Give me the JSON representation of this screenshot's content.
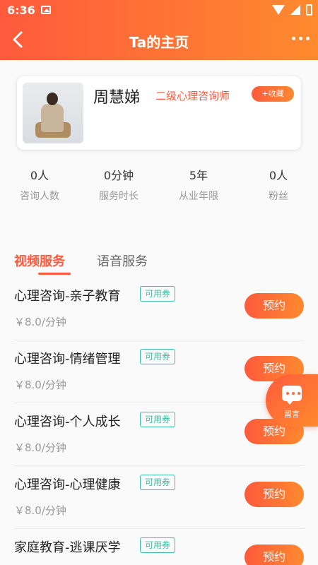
{
  "status_bar": {
    "time": "6:36"
  },
  "nav": {
    "title": "Ta的主页"
  },
  "profile": {
    "name": "周慧娣",
    "level": "二级心理咨询师",
    "favorite_label": "+收藏"
  },
  "stats": [
    {
      "value": "0人",
      "label": "咨询人数"
    },
    {
      "value": "0分钟",
      "label": "服务时长"
    },
    {
      "value": "5年",
      "label": "从业年限"
    },
    {
      "value": "0人",
      "label": "粉丝"
    }
  ],
  "tabs": [
    {
      "label": "视频服务",
      "active": true
    },
    {
      "label": "语音服务",
      "active": false
    }
  ],
  "services": [
    {
      "title": "心理咨询-亲子教育",
      "coupon": "可用券",
      "price": "￥8.0/分钟",
      "book_label": "预约"
    },
    {
      "title": "心理咨询-情绪管理",
      "coupon": "可用券",
      "price": "￥8.0/分钟",
      "book_label": "预约"
    },
    {
      "title": "心理咨询-个人成长",
      "coupon": "可用券",
      "price": "￥8.0/分钟",
      "book_label": "预约"
    },
    {
      "title": "心理咨询-心理健康",
      "coupon": "可用券",
      "price": "￥8.0/分钟",
      "book_label": "预约"
    },
    {
      "title": "家庭教育-逃课厌学",
      "coupon": "可用券",
      "price": "",
      "book_label": "预约"
    }
  ],
  "float_button": {
    "label": "留言"
  },
  "colors": {
    "accent": "#ff5a3c",
    "accent_end": "#ff8a2e",
    "coupon": "#3cbfa8"
  }
}
